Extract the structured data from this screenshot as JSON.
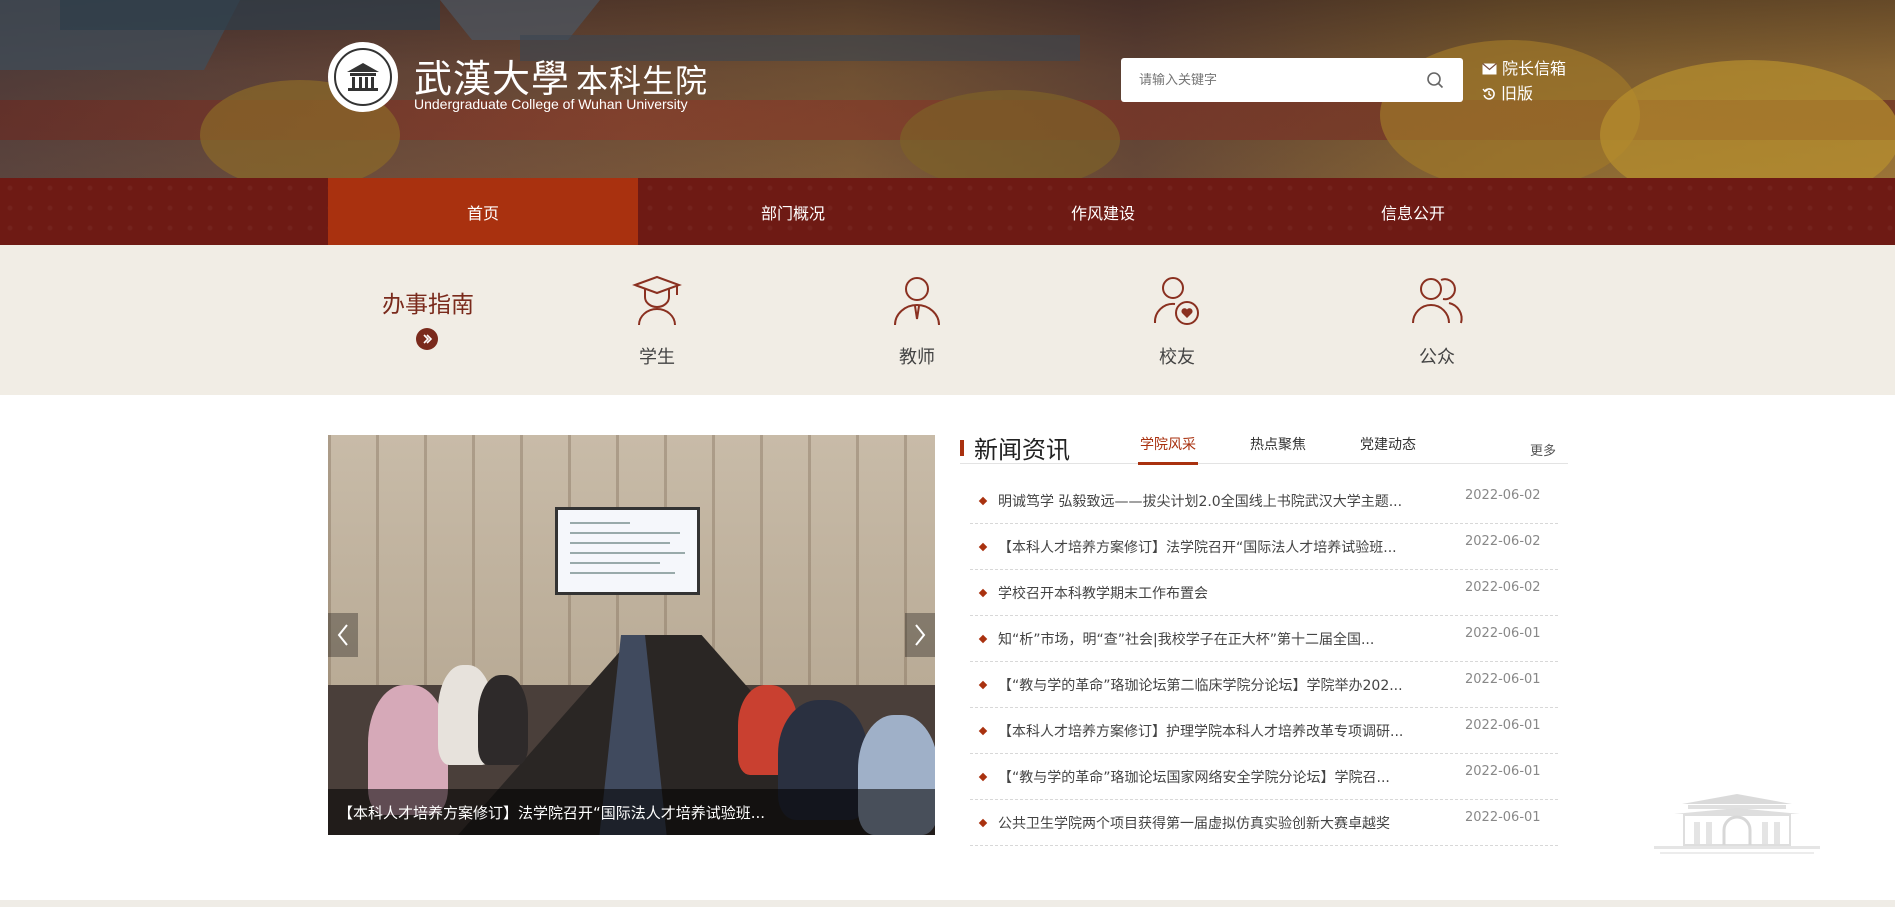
{
  "header": {
    "logo_cn_calligraphy": "武漢大學",
    "logo_cn_college": "本科生院",
    "logo_en": "Undergraduate College of Wuhan University",
    "search_placeholder": "请输入关键字",
    "links": [
      {
        "label": "院长信箱",
        "icon": "envelope-icon"
      },
      {
        "label": "旧版",
        "icon": "history-icon"
      }
    ]
  },
  "nav": {
    "items": [
      {
        "label": "首页",
        "active": true
      },
      {
        "label": "部门概况",
        "active": false
      },
      {
        "label": "作风建设",
        "active": false
      },
      {
        "label": "信息公开",
        "active": false
      }
    ]
  },
  "guide": {
    "title": "办事指南",
    "items": [
      {
        "label": "学生",
        "icon": "graduation-cap-icon"
      },
      {
        "label": "教师",
        "icon": "teacher-icon"
      },
      {
        "label": "校友",
        "icon": "alumni-heart-icon"
      },
      {
        "label": "公众",
        "icon": "public-group-icon"
      }
    ]
  },
  "slider": {
    "caption": "【本科人才培养方案修订】法学院召开“国际法人才培养试验班..."
  },
  "news": {
    "title": "新闻资讯",
    "tabs": [
      {
        "label": "学院风采",
        "active": true
      },
      {
        "label": "热点聚焦",
        "active": false
      },
      {
        "label": "党建动态",
        "active": false
      }
    ],
    "more": "更多",
    "items": [
      {
        "title": "明诚笃学 弘毅致远——拔尖计划2.0全国线上书院武汉大学主题...",
        "date": "2022-06-02"
      },
      {
        "title": "【本科人才培养方案修订】法学院召开“国际法人才培养试验班...",
        "date": "2022-06-02"
      },
      {
        "title": "学校召开本科教学期末工作布置会",
        "date": "2022-06-02"
      },
      {
        "title": "知“析”市场，明“查”社会|我校学子在正大杯”第十二届全国...",
        "date": "2022-06-01"
      },
      {
        "title": "【“教与学的革命”珞珈论坛第二临床学院分论坛】学院举办202...",
        "date": "2022-06-01"
      },
      {
        "title": "【本科人才培养方案修订】护理学院本科人才培养改革专项调研...",
        "date": "2022-06-01"
      },
      {
        "title": "【“教与学的革命”珞珈论坛国家网络安全学院分论坛】学院召...",
        "date": "2022-06-01"
      },
      {
        "title": "公共卫生学院两个项目获得第一届虚拟仿真实验创新大赛卓越奖",
        "date": "2022-06-01"
      }
    ]
  },
  "colors": {
    "nav_bg": "#6e1a14",
    "nav_active": "#a9310f",
    "accent": "#a9310f",
    "guide_bg": "#f1ede5"
  }
}
